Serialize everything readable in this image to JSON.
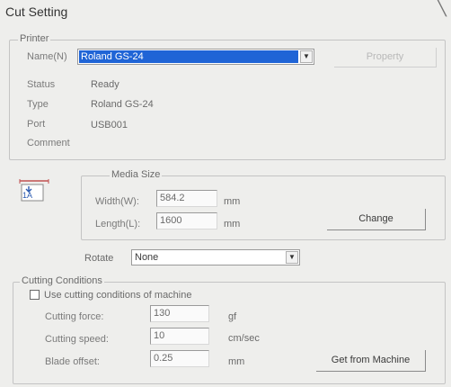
{
  "window": {
    "title": "Cut Setting"
  },
  "printer": {
    "legend": "Printer",
    "name_label": "Name(N)",
    "name_value": "Roland GS-24",
    "property_button": "Property",
    "status_label": "Status",
    "status_value": "Ready",
    "type_label": "Type",
    "type_value": "Roland GS-24",
    "port_label": "Port",
    "port_value": "USB001",
    "comment_label": "Comment"
  },
  "media": {
    "legend": "Media Size",
    "width_label": "Width(W):",
    "width_value": "584.2",
    "width_unit": "mm",
    "length_label": "Length(L):",
    "length_value": "1600",
    "length_unit": "mm",
    "change_button": "Change",
    "media_icon_text": "1A",
    "rotate_label": "Rotate",
    "rotate_value": "None"
  },
  "cutting": {
    "legend": "Cutting Conditions",
    "use_machine_label": "Use cutting conditions of machine",
    "force_label": "Cutting force:",
    "force_value": "130",
    "force_unit": "gf",
    "speed_label": "Cutting speed:",
    "speed_value": "10",
    "speed_unit": "cm/sec",
    "offset_label": "Blade offset:",
    "offset_value": "0.25",
    "offset_unit": "mm",
    "get_button": "Get from Machine"
  }
}
